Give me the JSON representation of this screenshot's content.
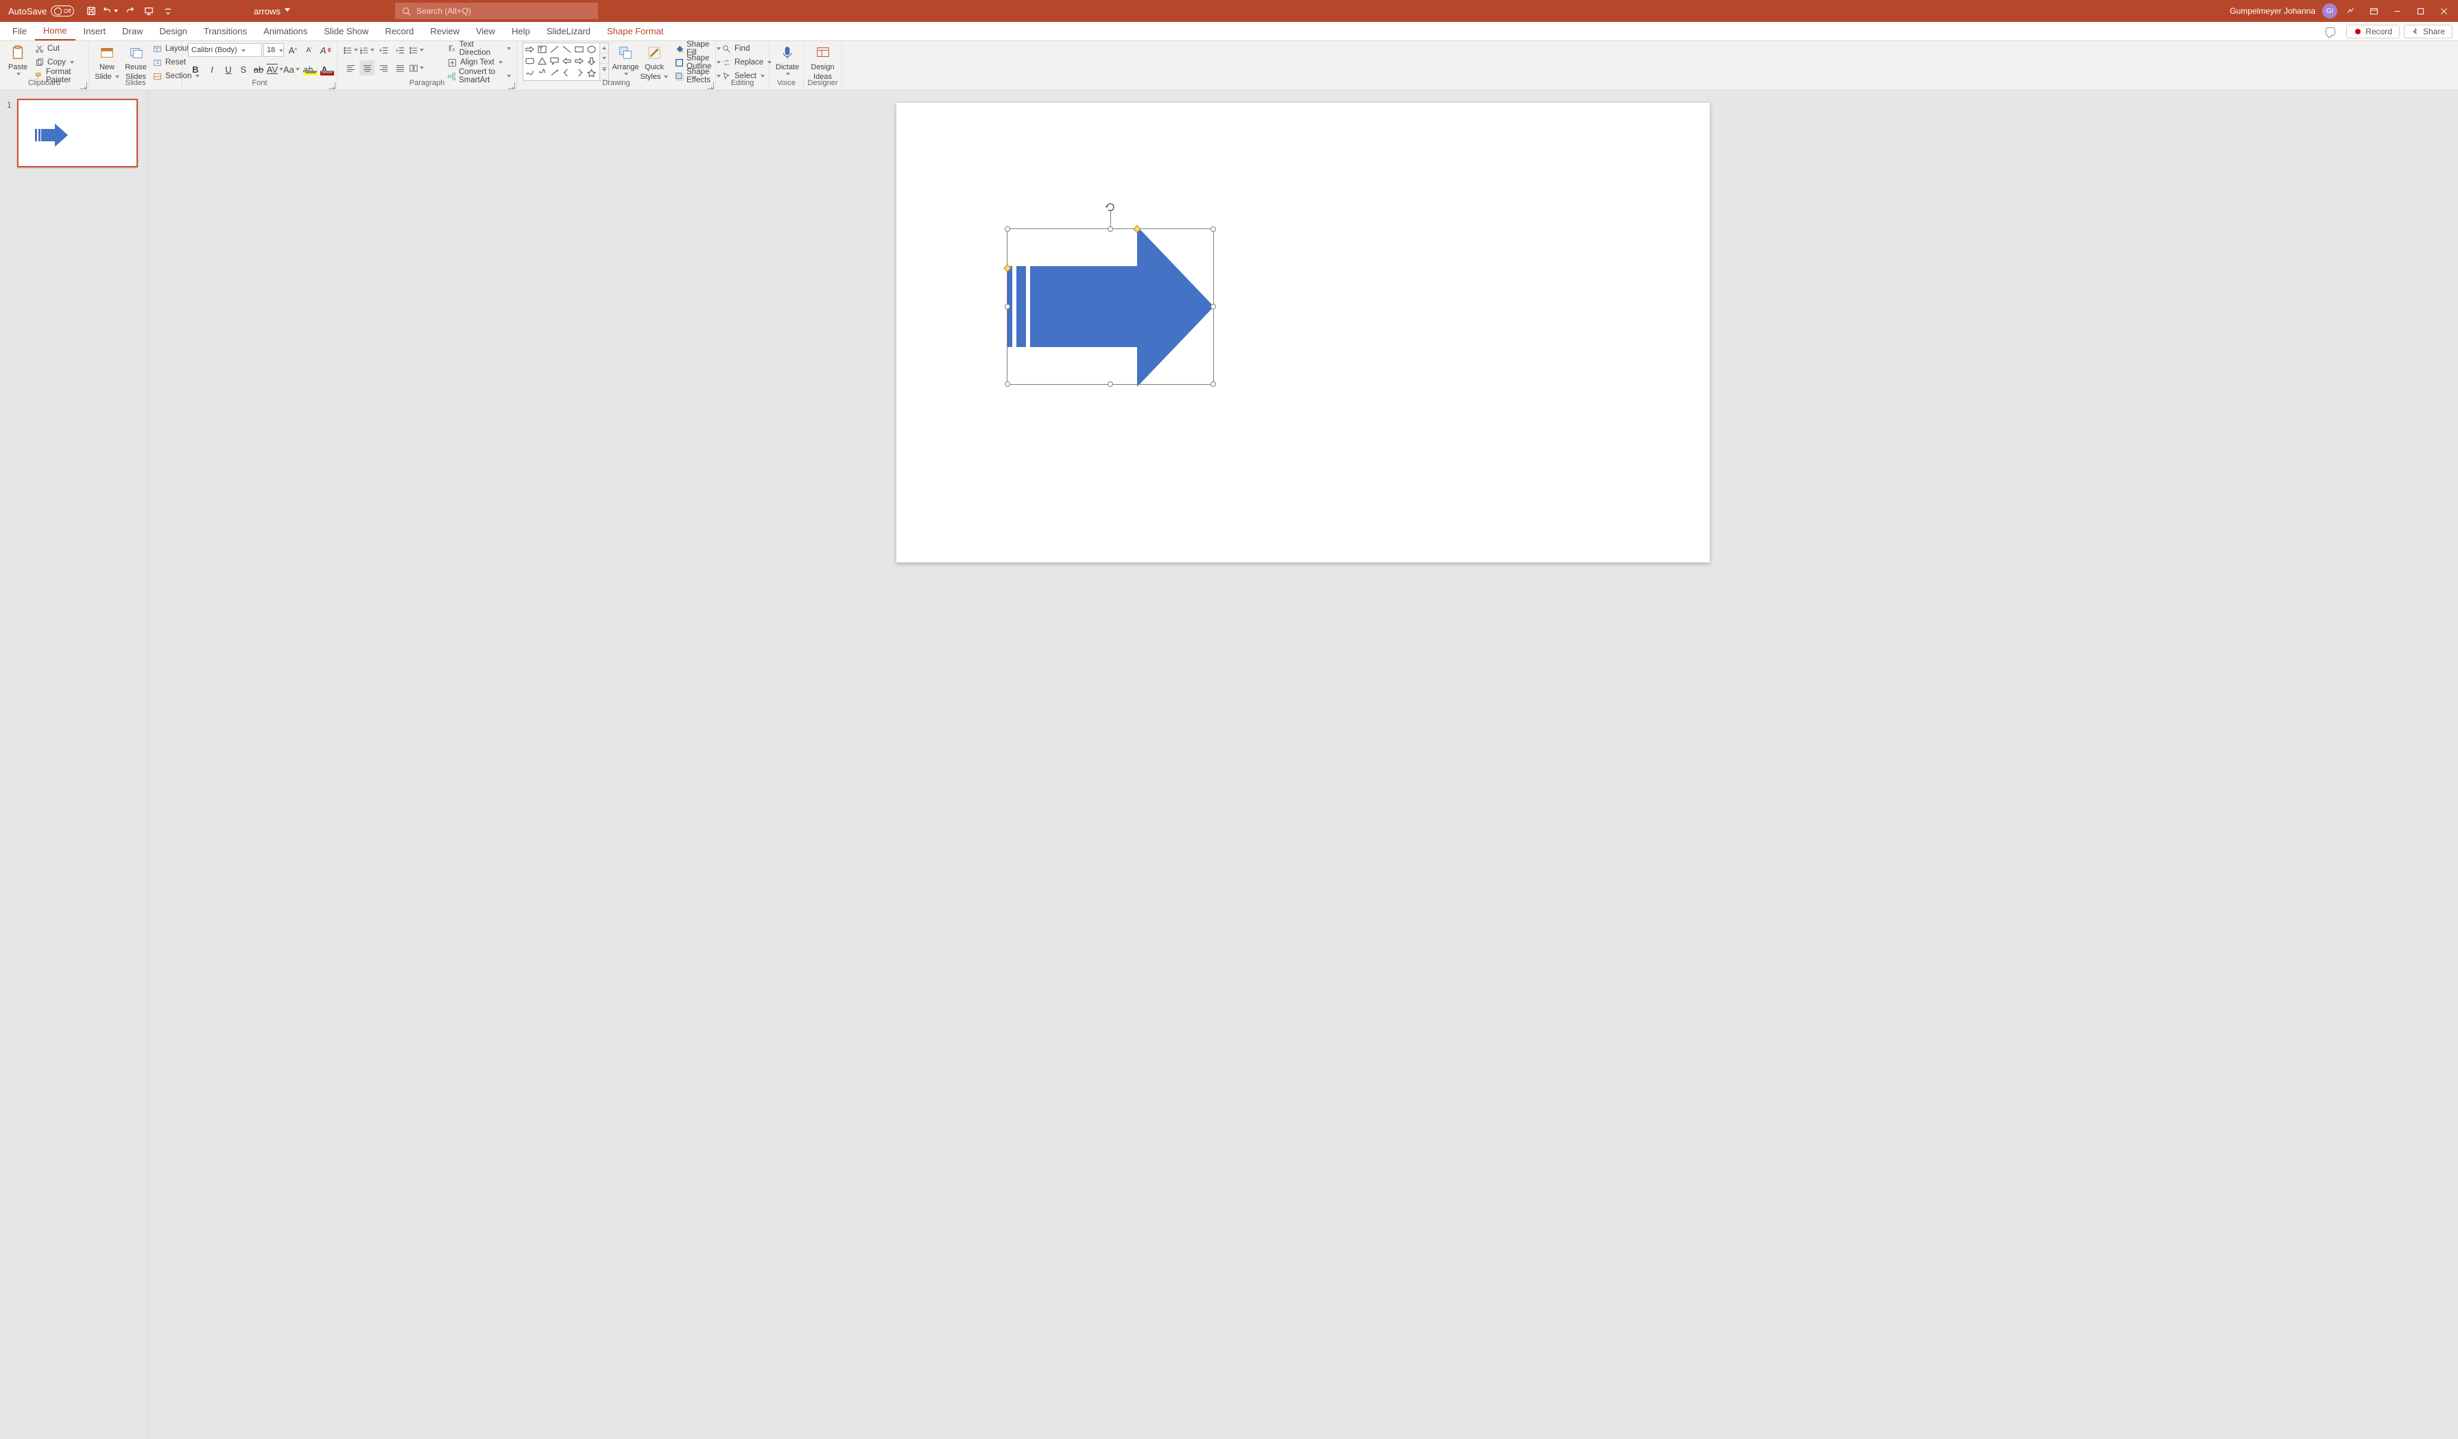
{
  "titlebar": {
    "autosave_label": "AutoSave",
    "autosave_state": "Off",
    "doc_name": "arrows",
    "search_placeholder": "Search (Alt+Q)",
    "user_name": "Gumpelmeyer Johanna",
    "user_initials": "GI"
  },
  "tabs": {
    "file": "File",
    "home": "Home",
    "insert": "Insert",
    "draw": "Draw",
    "design": "Design",
    "transitions": "Transitions",
    "animations": "Animations",
    "slideshow": "Slide Show",
    "record": "Record",
    "review": "Review",
    "view": "View",
    "help": "Help",
    "slidelizard": "SlideLizard",
    "shapeformat": "Shape Format",
    "right": {
      "record": "Record",
      "share": "Share"
    }
  },
  "ribbon": {
    "clipboard": {
      "group": "Clipboard",
      "paste": "Paste",
      "cut": "Cut",
      "copy": "Copy",
      "painter": "Format Painter"
    },
    "slides": {
      "group": "Slides",
      "new": "New",
      "new2": "Slide",
      "reuse": "Reuse",
      "reuse2": "Slides",
      "layout": "Layout",
      "reset": "Reset",
      "section": "Section"
    },
    "font": {
      "group": "Font",
      "name": "Calibri (Body)",
      "size": "18",
      "aa": "Aa",
      "av": "AV",
      "k": "ab",
      "A": "A"
    },
    "paragraph": {
      "group": "Paragraph",
      "textdir": "Text Direction",
      "align": "Align Text",
      "smartart": "Convert to SmartArt"
    },
    "drawing": {
      "group": "Drawing",
      "arrange": "Arrange",
      "quick": "Quick",
      "styles": "Styles",
      "fill": "Shape Fill",
      "outline": "Shape Outline",
      "effects": "Shape Effects"
    },
    "editing": {
      "group": "Editing",
      "find": "Find",
      "replace": "Replace",
      "select": "Select"
    },
    "voice": {
      "group": "Voice",
      "dictate": "Dictate"
    },
    "designer": {
      "group": "Designer",
      "design": "Design",
      "ideas": "Ideas"
    }
  },
  "thumbs": {
    "slide1_num": "1"
  },
  "colors": {
    "accent": "#b7472a",
    "shape_fill": "#4472c4"
  }
}
